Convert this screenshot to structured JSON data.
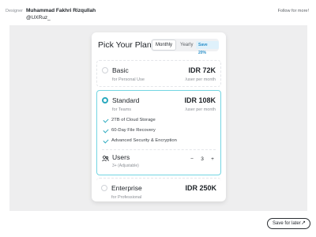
{
  "header": {
    "designer_label": "Designer",
    "designer_name": "Muhammad Fakhri Rizqullah",
    "designer_handle": "@UXRuz_",
    "follow_label": "Follow for more!"
  },
  "card": {
    "title": "Pick Your Plan",
    "toggle": {
      "monthly": "Monthly",
      "yearly": "Yearly",
      "save_badge": "Save 20%"
    },
    "plans": [
      {
        "name": "Basic",
        "subtitle": "for Personal Use",
        "price": "IDR 72K",
        "period": "/user per month",
        "selected": false
      },
      {
        "name": "Standard",
        "subtitle": "for Teams",
        "price": "IDR 108K",
        "period": "/user per month",
        "selected": true,
        "features": [
          "2TB of Cloud Storage",
          "60-Day File Recovery",
          "Advanced Security & Encryption"
        ],
        "users": {
          "label": "Users",
          "sub": "3+ (Adjustable)",
          "minus": "−",
          "value": "3",
          "plus": "+"
        }
      },
      {
        "name": "Enterprise",
        "subtitle": "for Professional",
        "price": "IDR 250K",
        "period": "/user per month",
        "selected": false
      }
    ]
  },
  "footer": {
    "save_later": "Save for later",
    "arrow_icon": "↗"
  },
  "colors": {
    "accent": "#2aa9bf",
    "selected_border": "#73d5e2",
    "badge_bg": "#dff1fb",
    "badge_text": "#2a8fc9",
    "canvas": "#eeeeef"
  }
}
